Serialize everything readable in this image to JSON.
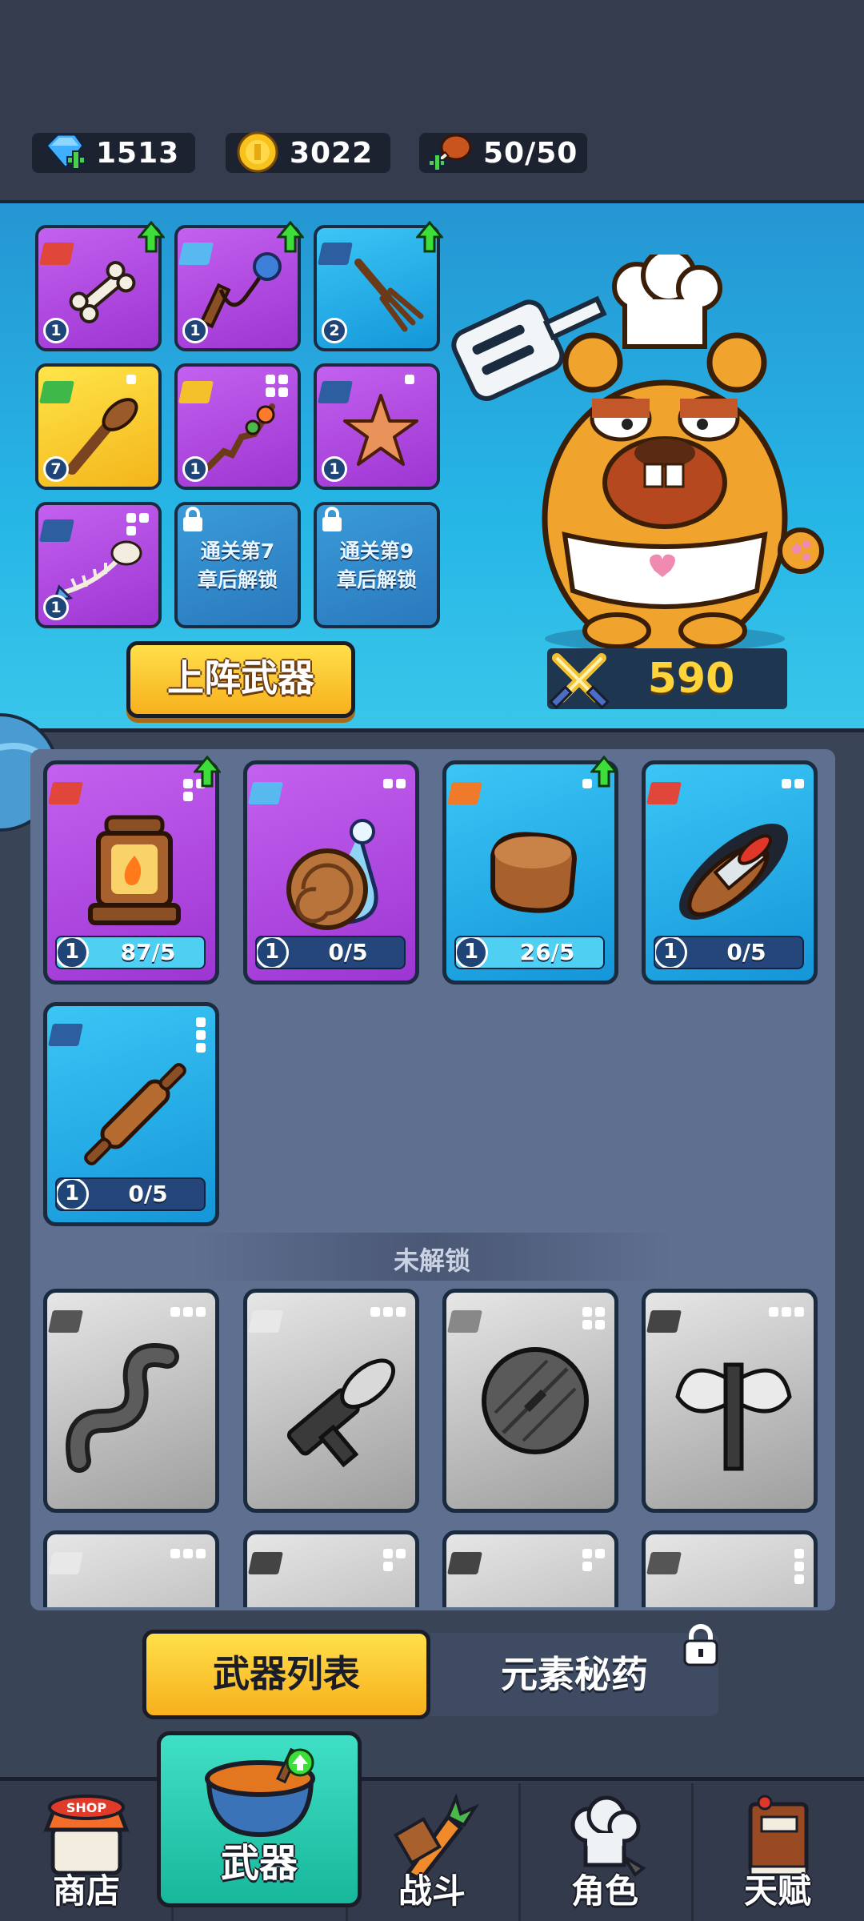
{
  "resources": {
    "gems": "1513",
    "coins": "3022",
    "stamina": "50/50"
  },
  "equipped": [
    {
      "id": "bone",
      "level": "1",
      "rarity": "purple",
      "upgrade": true
    },
    {
      "id": "nunchaku",
      "level": "1",
      "rarity": "purple",
      "upgrade": true
    },
    {
      "id": "fork",
      "level": "2",
      "rarity": "blue",
      "upgrade": true
    },
    {
      "id": "lettuce-club",
      "level": "7",
      "rarity": "yellow",
      "upgrade": false
    },
    {
      "id": "skewer",
      "level": "1",
      "rarity": "purple",
      "upgrade": false
    },
    {
      "id": "starfish",
      "level": "1",
      "rarity": "purple",
      "upgrade": false
    },
    {
      "id": "fish-bone",
      "level": "1",
      "rarity": "purple",
      "upgrade": false
    }
  ],
  "locked_slots": [
    {
      "line1": "通关第7",
      "line2": "章后解锁"
    },
    {
      "line1": "通关第9",
      "line2": "章后解锁"
    }
  ],
  "deploy_button": "上阵武器",
  "power": "590",
  "inventory": [
    {
      "id": "lantern",
      "level": "1",
      "progress": "87/5",
      "fill": 1.0,
      "rarity": "purple",
      "upgrade": true,
      "element": "fire"
    },
    {
      "id": "snail",
      "level": "1",
      "progress": "0/5",
      "fill": 0.0,
      "rarity": "purple",
      "upgrade": false,
      "element": "ice"
    },
    {
      "id": "wood-block",
      "level": "1",
      "progress": "26/5",
      "fill": 1.0,
      "rarity": "blue",
      "upgrade": true,
      "element": "earth"
    },
    {
      "id": "pepper-knife",
      "level": "1",
      "progress": "0/5",
      "fill": 0.0,
      "rarity": "blue",
      "upgrade": false,
      "element": "fire"
    },
    {
      "id": "rolling-pin",
      "level": "1",
      "progress": "0/5",
      "fill": 0.0,
      "rarity": "blue",
      "upgrade": false,
      "element": "blade"
    }
  ],
  "locked_section_title": "未解锁",
  "locked_weapons": [
    "eel",
    "corn-gun",
    "round-shield",
    "double-axe"
  ],
  "tabs": {
    "weapons_list": "武器列表",
    "elixir": "元素秘药"
  },
  "nav": {
    "shop": "商店",
    "weapons": "武器",
    "battle": "战斗",
    "character": "角色",
    "talent": "天赋"
  },
  "shop_sign": "SHOP"
}
